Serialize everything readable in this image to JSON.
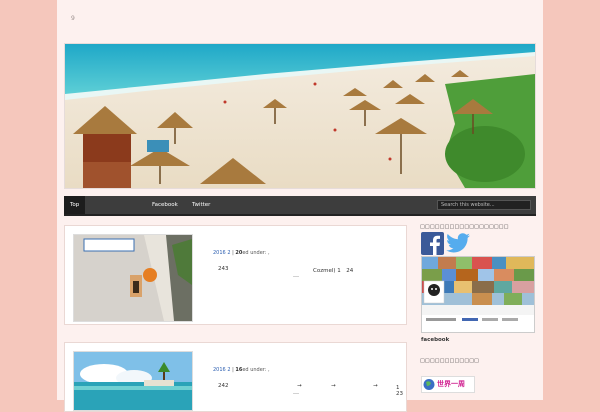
{
  "site": {
    "description": "9"
  },
  "nav": {
    "items": [
      "Top",
      "Facebook",
      "Twitter"
    ],
    "search_placeholder": "Search this website..."
  },
  "posts": [
    {
      "meta_year": "2016",
      "meta_month": "2",
      "meta_day": "20",
      "meta_filed": "ed under: ,",
      "excerpt_left": "243",
      "excerpt_right": "Cozmel) 1　24",
      "more": "…"
    },
    {
      "meta_year": "2016",
      "meta_month": "2",
      "meta_day": "16",
      "meta_filed": "ed under: ,",
      "excerpt_left": "242",
      "arrows": [
        "→",
        "→",
        "→"
      ],
      "excerpt_nums": "1　23",
      "more": "…"
    }
  ],
  "sidebar": {
    "sns_title": "□□□□□□□□□□□□□□□□□□",
    "facebook_label": "facebook",
    "links_title": "□□□□□□□□□□□□",
    "badge_text": "世界一周"
  },
  "colors": {
    "background": "#f5c7bc",
    "page": "#fdf1ef",
    "nav": "#3d3d3d",
    "link_blue": "#2a5db0",
    "facebook_blue": "#3b5998",
    "twitter_blue": "#55acee"
  }
}
